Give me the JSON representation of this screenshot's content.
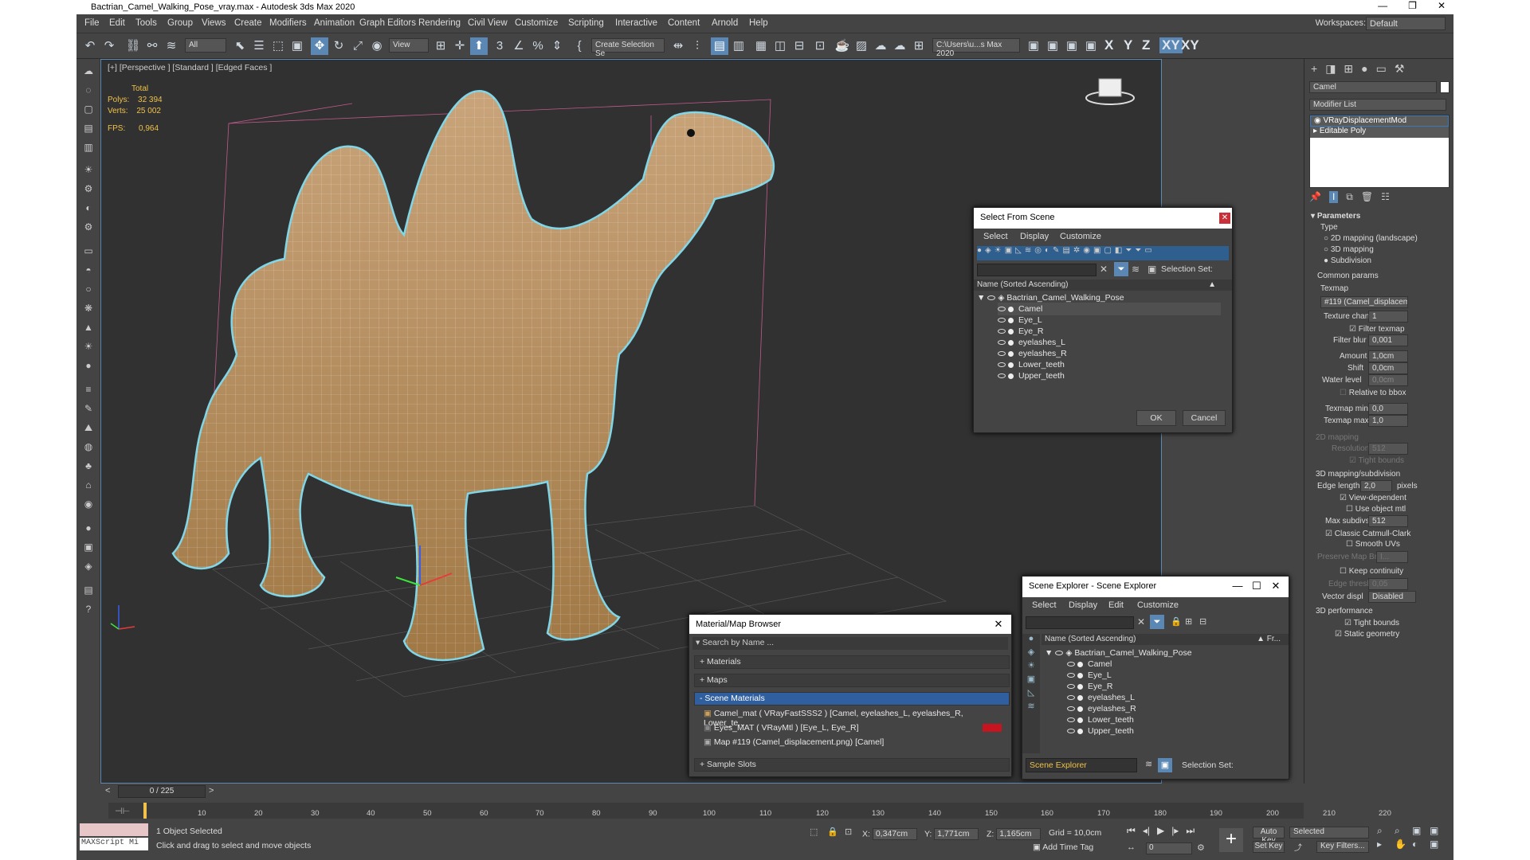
{
  "title": "Bactrian_Camel_Walking_Pose_vray.max - Autodesk 3ds Max 2020",
  "window_controls": [
    "—",
    "❐",
    "✕"
  ],
  "menu": [
    "File",
    "Edit",
    "Tools",
    "Group",
    "Views",
    "Create",
    "Modifiers",
    "Animation",
    "Graph Editors",
    "Rendering",
    "Civil View",
    "Customize",
    "Scripting",
    "Interactive",
    "Content",
    "Arnold",
    "Help"
  ],
  "workspace": {
    "label": "Workspaces:",
    "value": "Default"
  },
  "toolbar": {
    "filter": "All",
    "refcoord": "View",
    "selset": "Create Selection Se",
    "path": "C:\\Users\\u...s Max 2020",
    "axes": [
      "X",
      "Y",
      "Z",
      "XY",
      "XY"
    ]
  },
  "viewport": {
    "label": "[+] [Perspective ] [Standard ] [Edged Faces ]",
    "stats": {
      "header": "Total",
      "polys_label": "Polys:",
      "polys": "32 394",
      "verts_label": "Verts:",
      "verts": "25 002",
      "fps_label": "FPS:",
      "fps": "0,964"
    }
  },
  "right_panel": {
    "object_name": "Camel",
    "modifier_list": "Modifier List",
    "stack": [
      "VRayDisplacementMod",
      "Editable Poly"
    ],
    "params": {
      "title": "Parameters",
      "type_label": "Type",
      "types": [
        "2D mapping (landscape)",
        "3D mapping",
        "Subdivision"
      ],
      "common": "Common params",
      "texmap_label": "Texmap",
      "texmap": "#119 (Camel_displacement.p",
      "texchan_label": "Texture chan",
      "texchan": "1",
      "filter_texmap": "Filter texmap",
      "filterblur_label": "Filter blur",
      "filterblur": "0,001",
      "amount_label": "Amount",
      "amount": "1,0cm",
      "shift_label": "Shift",
      "shift": "0,0cm",
      "water_label": "Water level",
      "water": "0,0cm",
      "relative": "Relative to bbox",
      "tmin_label": "Texmap min",
      "tmin": "0,0",
      "tmax_label": "Texmap max",
      "tmax": "1,0",
      "map2d": "2D mapping",
      "res_label": "Resolution",
      "res": "512",
      "tight1": "Tight bounds",
      "map3d": "3D mapping/subdivision",
      "edge_label": "Edge length",
      "edge": "2,0",
      "pixels": "pixels",
      "viewdep": "View-dependent",
      "useobj": "Use object mtl",
      "maxsub_label": "Max subdivs",
      "maxsub": "512",
      "catmull": "Classic Catmull-Clark",
      "smoothuv": "Smooth UVs",
      "preserve_label": "Preserve Map Bnd",
      "preserve": "I...",
      "keepcont": "Keep continuity",
      "edgethr_label": "Edge thresh",
      "edgethr": "0,05",
      "vecdisp_label": "Vector displ",
      "vecdisp": "Disabled",
      "perf": "3D performance",
      "tight2": "Tight bounds",
      "static": "Static geometry"
    }
  },
  "select_dialog": {
    "title": "Select From Scene",
    "menu": [
      "Select",
      "Display",
      "Customize"
    ],
    "selection_set": "Selection Set:",
    "column": "Name (Sorted Ascending)",
    "root": "Bactrian_Camel_Walking_Pose",
    "items": [
      "Camel",
      "Eye_L",
      "Eye_R",
      "eyelashes_L",
      "eyelashes_R",
      "Lower_teeth",
      "Upper_teeth"
    ],
    "ok": "OK",
    "cancel": "Cancel"
  },
  "scene_explorer": {
    "title": "Scene Explorer - Scene Explorer",
    "menu": [
      "Select",
      "Display",
      "Edit",
      "Customize"
    ],
    "column": "Name (Sorted Ascending)",
    "column2": "▲ Fr...",
    "root": "Bactrian_Camel_Walking_Pose",
    "items": [
      "Camel",
      "Eye_L",
      "Eye_R",
      "eyelashes_L",
      "eyelashes_R",
      "Lower_teeth",
      "Upper_teeth"
    ],
    "footer_name": "Scene Explorer",
    "selection_set": "Selection Set:"
  },
  "material_browser": {
    "title": "Material/Map Browser",
    "search": "Search by Name ...",
    "groups": [
      "+ Materials",
      "+ Maps",
      "- Scene Materials",
      "+ Sample Slots"
    ],
    "scene_materials": [
      "Camel_mat  ( VRayFastSSS2 ) [Camel, eyelashes_L, eyelashes_R, Lower_te...",
      "Eyes_MAT  ( VRayMtl ) [Eye_L, Eye_R]",
      "Map #119 (Camel_displacement.png) [Camel]"
    ]
  },
  "timeline": {
    "frame": "0 / 225",
    "ticks": [
      "10",
      "20",
      "30",
      "40",
      "50",
      "60",
      "70",
      "80",
      "90",
      "100",
      "110",
      "120",
      "130",
      "140",
      "150",
      "160",
      "170",
      "180",
      "190",
      "200",
      "210",
      "220"
    ]
  },
  "status": {
    "script": "MAXScript Mi",
    "selected": "1 Object Selected",
    "hint": "Click and drag to select and move objects",
    "x_label": "X:",
    "x": "0,347cm",
    "y_label": "Y:",
    "y": "1,771cm",
    "z_label": "Z:",
    "z": "1,165cm",
    "grid": "Grid = 10,0cm",
    "addtag": "Add Time Tag",
    "autokey": "Auto Key",
    "setkey": "Set Key",
    "selected_mode": "Selected",
    "keyfilters": "Key Filters...",
    "frame_field": "0"
  }
}
